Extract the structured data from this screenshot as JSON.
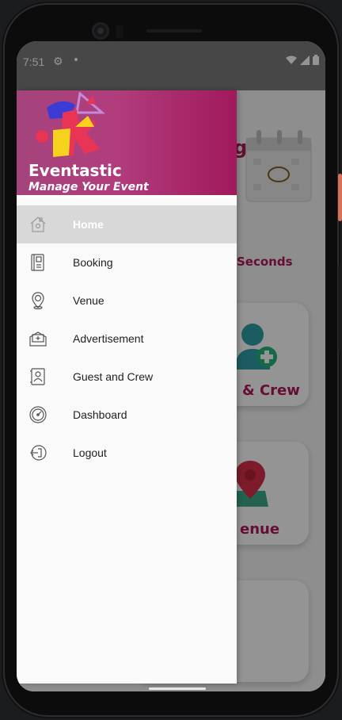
{
  "status_bar": {
    "time": "7:51",
    "icons": [
      "gear-icon",
      "notification-dot",
      "wifi-icon",
      "signal-icon",
      "battery-icon"
    ]
  },
  "drawer": {
    "app_name": "Eventastic",
    "tagline": "Manage Your Event",
    "items": [
      {
        "label": "Home",
        "icon": "home-icon",
        "active": true
      },
      {
        "label": "Booking",
        "icon": "booking-icon",
        "active": false
      },
      {
        "label": "Venue",
        "icon": "venue-pin-icon",
        "active": false
      },
      {
        "label": "Advertisement",
        "icon": "advertisement-icon",
        "active": false
      },
      {
        "label": "Guest and Crew",
        "icon": "guest-crew-icon",
        "active": false
      },
      {
        "label": "Dashboard",
        "icon": "dashboard-icon",
        "active": false
      },
      {
        "label": "Logout",
        "icon": "logout-icon",
        "active": false
      }
    ]
  },
  "background": {
    "seconds_label": "Seconds",
    "card_crew_label": "& Crew",
    "card_venue_label": "enue",
    "partial_letter": "g"
  },
  "colors": {
    "accent": "#b0185a",
    "header_start": "#a4437c",
    "header_end": "#a1195c"
  }
}
